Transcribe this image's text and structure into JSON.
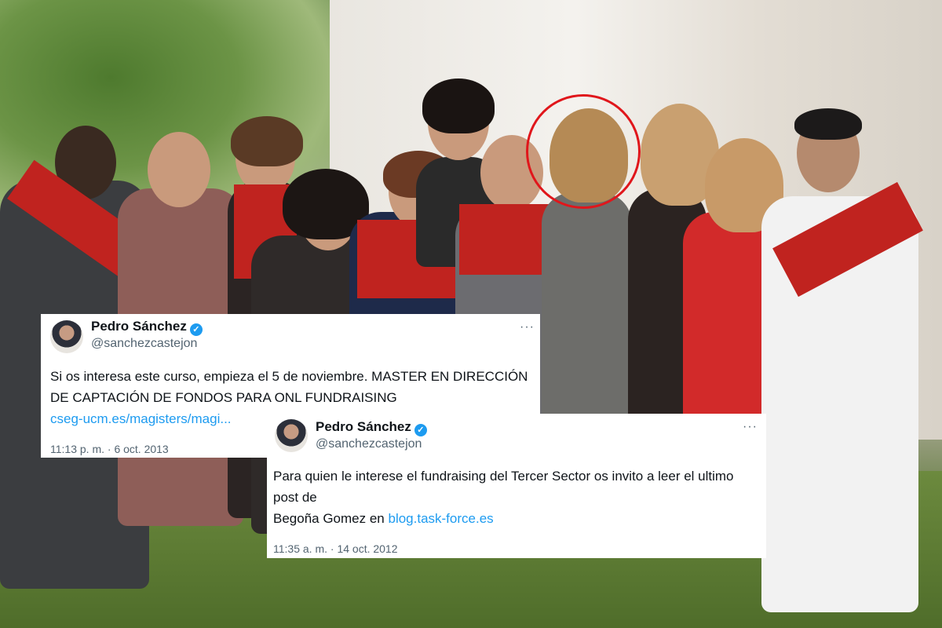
{
  "tweets": [
    {
      "name": "Pedro Sánchez",
      "handle": "@sanchezcastejon",
      "more": "···",
      "text": "Si os interesa este curso, empieza el 5 de noviembre. MASTER EN DIRECCIÓN DE CAPTACIÓN DE FONDOS PARA ONL FUNDRAISING",
      "link": "cseg-ucm.es/magisters/magi...",
      "timestamp": "11:13 p. m. · 6 oct. 2013"
    },
    {
      "name": "Pedro Sánchez",
      "handle": "@sanchezcastejon",
      "more": "···",
      "text_line1": "Para quien le interese el fundraising del Tercer Sector os invito a leer el ultimo post de",
      "text_line2_prefix": "Begoña Gomez en ",
      "link": "blog.task-force.es",
      "timestamp": "11:35 a. m. · 14 oct. 2012"
    }
  ],
  "colors": {
    "accent": "#1d9bf0",
    "text": "#0f1419",
    "muted": "#536471",
    "sash": "#c0231f",
    "highlight_circle": "#e0161b"
  },
  "icons": {
    "verified": "verified-badge-icon",
    "more": "more-options-icon"
  }
}
